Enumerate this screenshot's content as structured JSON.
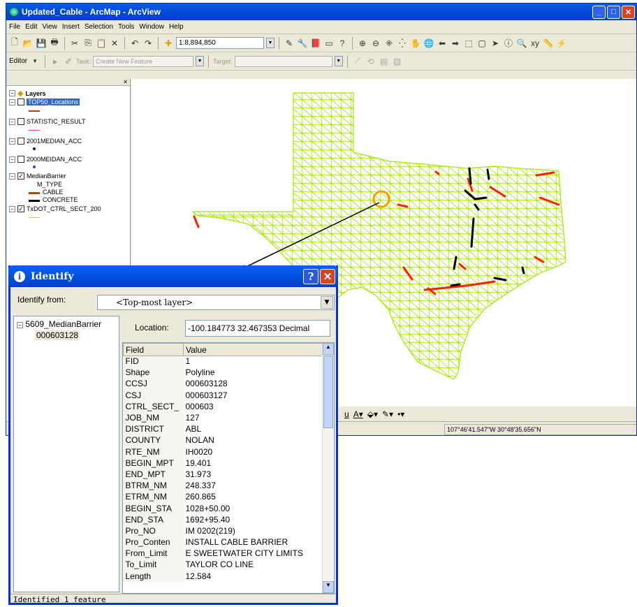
{
  "window": {
    "title": "Updated_Cable - ArcMap - ArcView"
  },
  "menu": [
    "File",
    "Edit",
    "View",
    "Insert",
    "Selection",
    "Tools",
    "Window",
    "Help"
  ],
  "toolbar": {
    "scale": "1:8,894,850"
  },
  "editor": {
    "label": "Editor",
    "task_label": "Task:",
    "task_value": "Create New Feature",
    "target_label": "Target:"
  },
  "toc": {
    "root": "Layers",
    "layers": [
      {
        "name": "TOP50_Locations",
        "checked": false
      },
      {
        "name": "STATISTIC_RESULT",
        "checked": false
      },
      {
        "name": "2001MEDIAN_ACC",
        "checked": false
      },
      {
        "name": "2000MEIDAN_ACC",
        "checked": false
      },
      {
        "name": "MedianBarrier",
        "checked": true
      },
      {
        "name": "TxDOT_CTRL_SECT_200",
        "checked": true
      }
    ],
    "legend_field": "M_TYPE",
    "legend": [
      {
        "label": "CABLE",
        "color": "#ff2000"
      },
      {
        "label": "CONCRETE",
        "color": "#000000"
      }
    ]
  },
  "statusbar": {
    "coords": "107°46'41.547\"W  30°48'35.656\"N"
  },
  "identify": {
    "title": "Identify",
    "from_label": "Identify from:",
    "from_value": "<Top-most layer>",
    "tree_layer": "5609_MedianBarrier",
    "tree_feature": "000603128",
    "location_label": "Location:",
    "location_value": "-100.184773  32.467353 Decimal",
    "field_header": "Field",
    "value_header": "Value",
    "status": "Identified 1 feature",
    "rows": [
      [
        "FID",
        "1"
      ],
      [
        "Shape",
        "Polyline"
      ],
      [
        "CCSJ",
        "000603128"
      ],
      [
        "CSJ",
        "000603127"
      ],
      [
        "CTRL_SECT_",
        "000603"
      ],
      [
        "JOB_NM",
        "127"
      ],
      [
        "DISTRICT",
        "ABL"
      ],
      [
        "COUNTY",
        "NOLAN"
      ],
      [
        "RTE_NM",
        "IH0020"
      ],
      [
        "BEGIN_MPT",
        "19.401"
      ],
      [
        "END_MPT",
        "31.973"
      ],
      [
        "BTRM_NM",
        "248.337"
      ],
      [
        "ETRM_NM",
        "260.865"
      ],
      [
        "BEGIN_STA",
        "1028+50.00"
      ],
      [
        "END_STA",
        "1692+95.40"
      ],
      [
        "Pro_NO",
        "IM 0202(219)"
      ],
      [
        "Pro_Conten",
        "INSTALL CABLE BARRIER"
      ],
      [
        "From_Limit",
        "E SWEETWATER CITY LIMITS"
      ],
      [
        "To_Limit",
        "TAYLOR CO LINE"
      ],
      [
        "Length",
        "12.584"
      ]
    ]
  },
  "colors": {
    "roads": "#a4e800",
    "cable": "#ff2000",
    "concrete": "#000000",
    "highlight_circle": "#f0a000",
    "xp_blue": "#0a5ee8"
  }
}
